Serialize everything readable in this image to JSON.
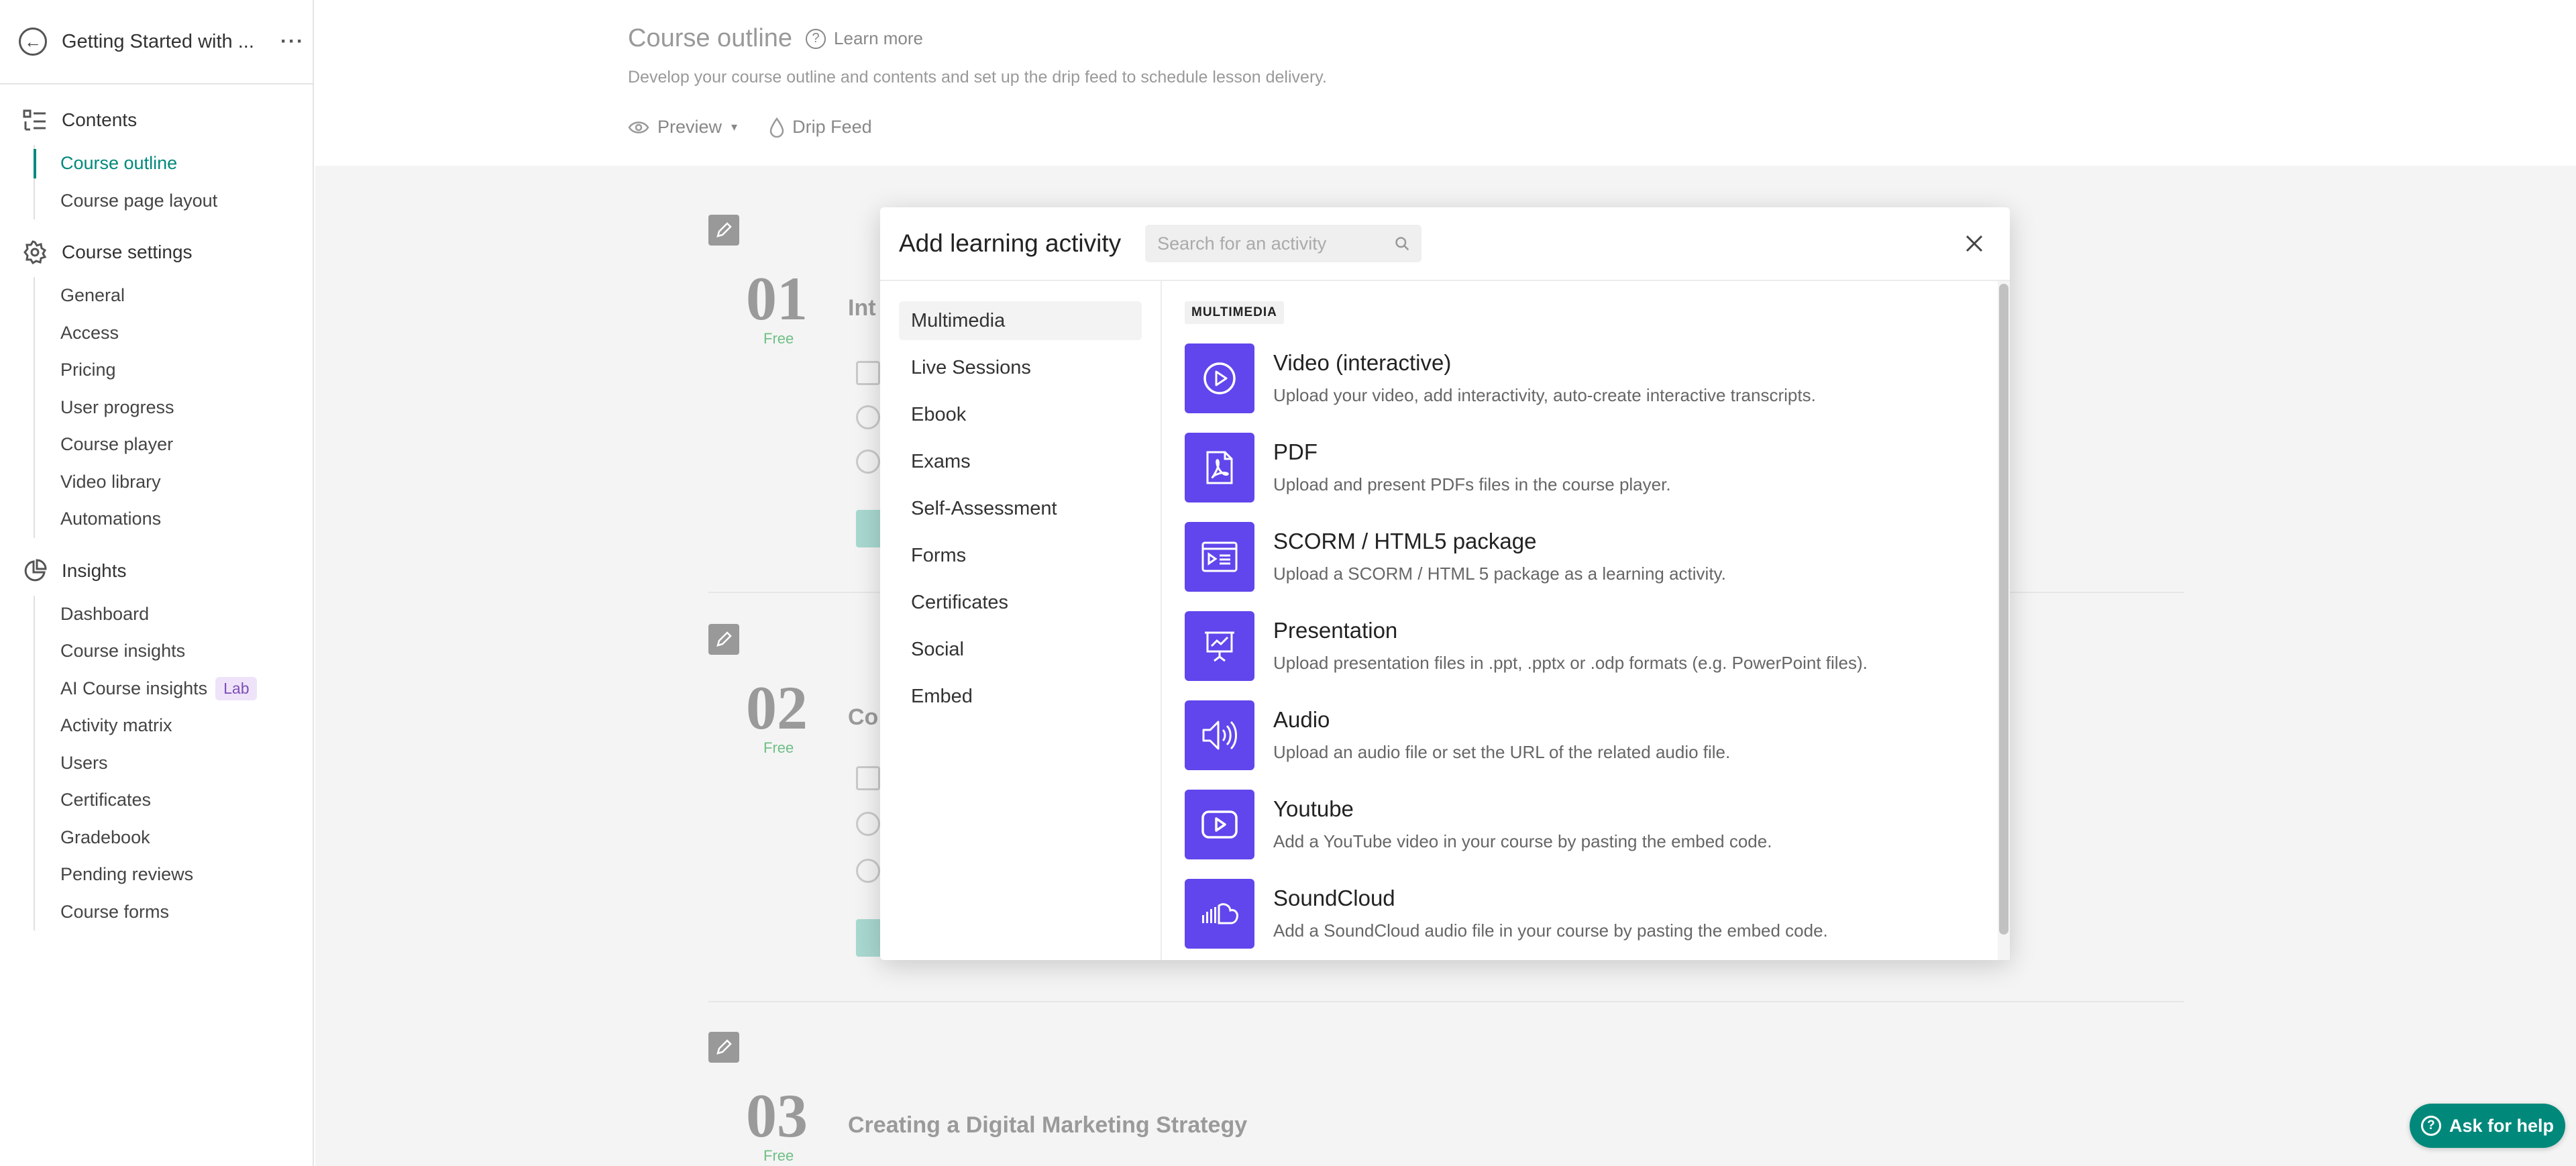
{
  "sidebar": {
    "course_title": "Getting Started with ...",
    "more_label": "···",
    "contents": {
      "heading": "Contents",
      "items": [
        {
          "label": "Course outline"
        },
        {
          "label": "Course page layout"
        }
      ]
    },
    "settings": {
      "heading": "Course settings",
      "items": [
        {
          "label": "General"
        },
        {
          "label": "Access"
        },
        {
          "label": "Pricing"
        },
        {
          "label": "User progress"
        },
        {
          "label": "Course player"
        },
        {
          "label": "Video library"
        },
        {
          "label": "Automations"
        }
      ]
    },
    "insights": {
      "heading": "Insights",
      "items": [
        {
          "label": "Dashboard"
        },
        {
          "label": "Course insights"
        },
        {
          "label": "AI Course insights",
          "badge": "Lab"
        },
        {
          "label": "Activity matrix"
        },
        {
          "label": "Users"
        },
        {
          "label": "Certificates"
        },
        {
          "label": "Gradebook"
        },
        {
          "label": "Pending reviews"
        },
        {
          "label": "Course forms"
        }
      ]
    }
  },
  "main": {
    "title": "Course outline",
    "learn_more": "Learn more",
    "subtitle": "Develop your course outline and contents and set up the drip feed to schedule lesson delivery.",
    "preview_label": "Preview",
    "drip_label": "Drip Feed",
    "chapters": [
      {
        "num": "01",
        "free": "Free",
        "title": "Int"
      },
      {
        "num": "02",
        "free": "Free",
        "title": "Co"
      },
      {
        "num": "03",
        "free": "Free",
        "title": "Creating a Digital Marketing Strategy"
      }
    ]
  },
  "modal": {
    "title": "Add learning activity",
    "search_placeholder": "Search for an activity",
    "categories": [
      {
        "label": "Multimedia"
      },
      {
        "label": "Live Sessions"
      },
      {
        "label": "Ebook"
      },
      {
        "label": "Exams"
      },
      {
        "label": "Self-Assessment"
      },
      {
        "label": "Forms"
      },
      {
        "label": "Certificates"
      },
      {
        "label": "Social"
      },
      {
        "label": "Embed"
      }
    ],
    "section_label": "MULTIMEDIA",
    "activities": [
      {
        "icon": "play-circle-icon",
        "title": "Video (interactive)",
        "desc": "Upload your video, add interactivity, auto-create interactive transcripts."
      },
      {
        "icon": "pdf-icon",
        "title": "PDF",
        "desc": "Upload and present PDFs files in the course player."
      },
      {
        "icon": "scorm-package-icon",
        "title": "SCORM / HTML5 package",
        "desc": "Upload a SCORM / HTML 5 package as a learning activity."
      },
      {
        "icon": "presentation-icon",
        "title": "Presentation",
        "desc": "Upload presentation files in .ppt, .pptx or .odp formats (e.g. PowerPoint files)."
      },
      {
        "icon": "speaker-icon",
        "title": "Audio",
        "desc": "Upload an audio file or set the URL of the related audio file."
      },
      {
        "icon": "youtube-icon",
        "title": "Youtube",
        "desc": "Add a YouTube video in your course by pasting the embed code."
      },
      {
        "icon": "soundcloud-icon",
        "title": "SoundCloud",
        "desc": "Add a SoundCloud audio file in your course by pasting the embed code."
      }
    ]
  },
  "help": {
    "label": "Ask for help"
  },
  "colors": {
    "accent": "#00897b",
    "activity_icon_bg": "#6046ec",
    "free": "#6fbf86"
  }
}
